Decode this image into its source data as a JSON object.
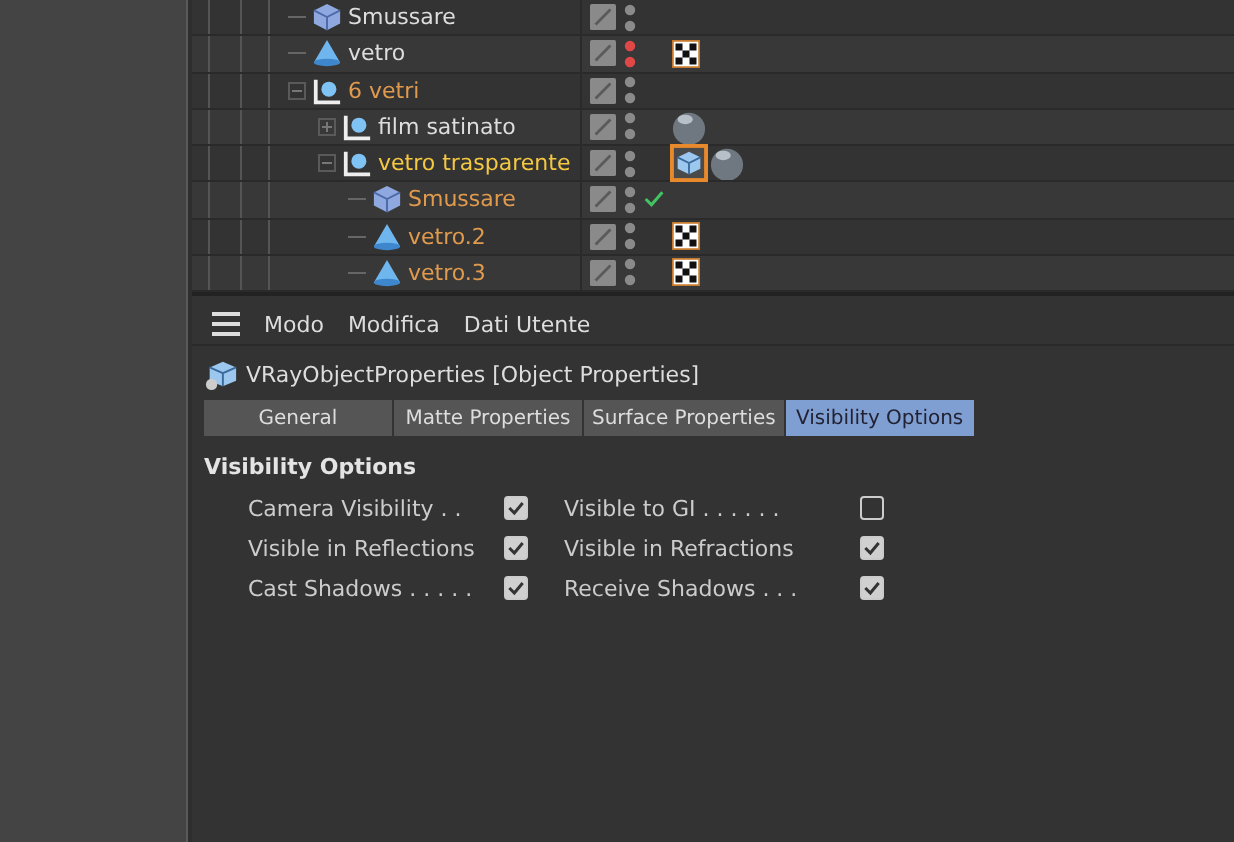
{
  "object_tree": [
    {
      "name": "Smussare",
      "kind": "cube",
      "selected": false,
      "primary": false,
      "hidden": false,
      "check": false
    },
    {
      "name": "vetro",
      "kind": "cone",
      "selected": false,
      "primary": false,
      "hidden": true,
      "check": false,
      "tags": [
        {
          "kind": "checker",
          "selected": false
        }
      ]
    },
    {
      "name": "6 vetri",
      "kind": "null",
      "selected": true,
      "primary": false,
      "hidden": false,
      "check": false,
      "expanded": true,
      "children": [
        {
          "name": "film satinato",
          "kind": "null",
          "selected": false,
          "primary": false,
          "hidden": false,
          "check": false,
          "expanded": false,
          "tags": [
            {
              "kind": "material",
              "selected": false
            }
          ]
        },
        {
          "name": "vetro trasparente",
          "kind": "null",
          "selected": true,
          "primary": true,
          "hidden": false,
          "check": false,
          "expanded": true,
          "tags": [
            {
              "kind": "vray",
              "selected": true
            },
            {
              "kind": "material",
              "selected": false
            }
          ],
          "children": [
            {
              "name": "Smussare",
              "kind": "cube",
              "selected": true,
              "primary": false,
              "hidden": false,
              "check": true
            },
            {
              "name": "vetro.2",
              "kind": "cone",
              "selected": true,
              "primary": false,
              "hidden": false,
              "check": false,
              "tags": [
                {
                  "kind": "checker",
                  "selected": false
                }
              ]
            },
            {
              "name": "vetro.3",
              "kind": "cone",
              "selected": true,
              "primary": false,
              "hidden": false,
              "check": false,
              "tags": [
                {
                  "kind": "checker",
                  "selected": false
                }
              ]
            }
          ]
        }
      ]
    }
  ],
  "menu": [
    "Modo",
    "Modifica",
    "Dati Utente"
  ],
  "object_title": "VRayObjectProperties [Object Properties]",
  "tabs": [
    {
      "label": "General",
      "selected": false
    },
    {
      "label": "Matte Properties",
      "selected": false
    },
    {
      "label": "Surface Properties",
      "selected": false
    },
    {
      "label": "Visibility Options",
      "selected": true
    }
  ],
  "section_title": "Visibility Options",
  "options": [
    {
      "label": "Camera Visibility",
      "dots": ". .",
      "checked": true
    },
    {
      "label": "Visible to GI",
      "dots": ". . . . . .",
      "checked": false
    },
    {
      "label": "Visible in Reflections",
      "checked": true
    },
    {
      "label": "Visible in Refractions",
      "checked": true
    },
    {
      "label": "Cast Shadows",
      "dots": ". . . . .",
      "checked": true
    },
    {
      "label": "Receive Shadows",
      "dots": ". . .",
      "checked": true
    }
  ]
}
